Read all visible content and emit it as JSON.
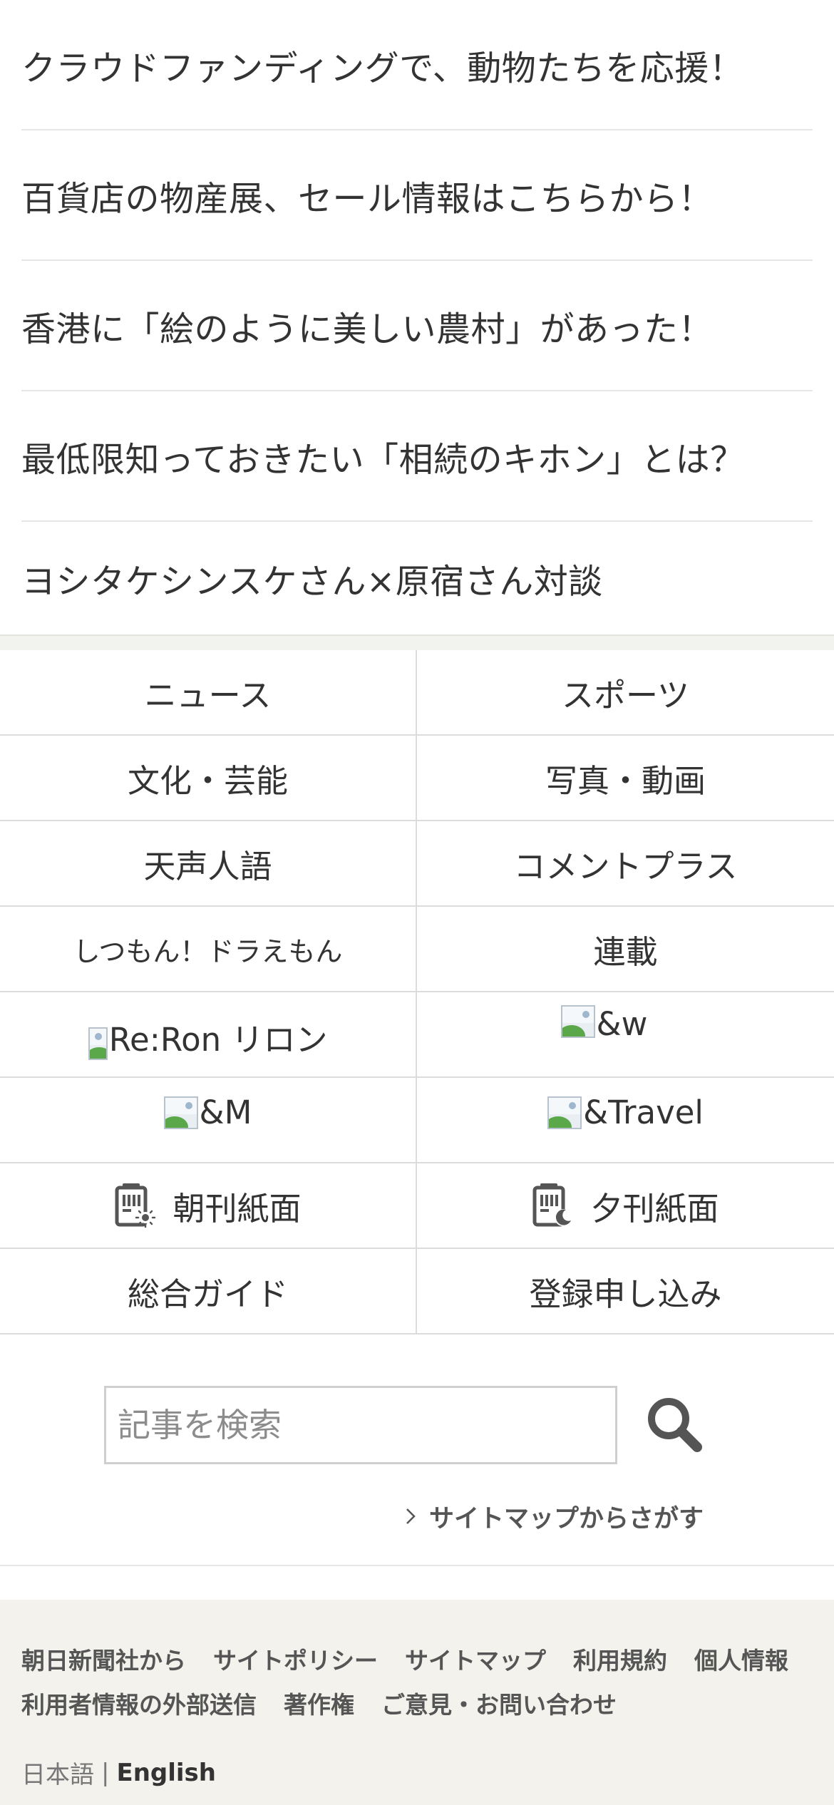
{
  "promos": [
    "クラウドファンディングで、動物たちを応援！",
    "百貨店の物産展、セール情報はこちらから！",
    "香港に「絵のように美しい農村」があった！",
    "最低限知っておきたい「相続のキホン」とは？",
    "ヨシタケシンスケさん×原宿さん対談"
  ],
  "categories": {
    "news": "ニュース",
    "sports": "スポーツ",
    "culture": "文化・芸能",
    "photo_video": "写真・動画",
    "tenseijingo": "天声人語",
    "comment_plus": "コメントプラス",
    "shitsumon": "しつもん！ドラえもん",
    "rensai": "連載",
    "reron": "Re:Ron リロン",
    "and_w": "&w",
    "and_m": "&M",
    "and_travel": "&Travel",
    "morning_paper": "朝刊紙面",
    "evening_paper": "夕刊紙面",
    "guide": "総合ガイド",
    "register": "登録申し込み"
  },
  "search": {
    "placeholder": "記事を検索",
    "sitemap_link": "サイトマップからさがす"
  },
  "footer": {
    "row1": [
      "朝日新聞社から",
      "サイトポリシー",
      "サイトマップ",
      "利用規約",
      "個人情報"
    ],
    "row2": [
      "利用者情報の外部送信",
      "著作権",
      "ご意見・お問い合わせ"
    ],
    "lang_ja": "日本語",
    "lang_sep": "|",
    "lang_en": "English"
  },
  "colors": {
    "text": "#333333",
    "divider": "#dcdcdc",
    "footer_bg": "#f3f2ec",
    "icon": "#555555"
  },
  "icons": {
    "search": "search-icon",
    "chevron": "chevron-right-icon",
    "morning_paper": "morning-paper-icon",
    "evening_paper": "evening-paper-icon",
    "broken_image": "broken-image-icon"
  }
}
